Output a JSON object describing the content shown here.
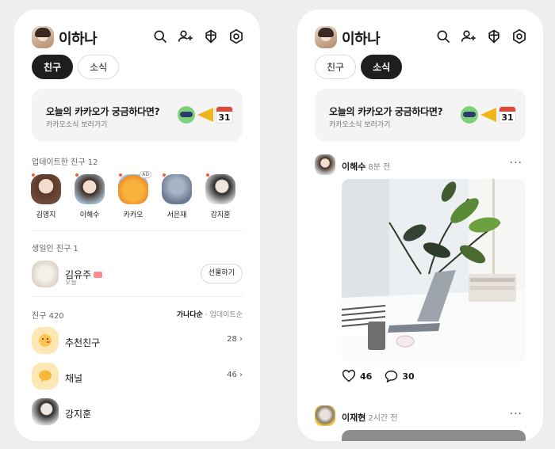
{
  "user": {
    "name": "이하나"
  },
  "header_icons": [
    "search-icon",
    "add-friend-icon",
    "gift-icon",
    "settings-icon"
  ],
  "tabs": {
    "friends": "친구",
    "news": "소식"
  },
  "banner": {
    "title": "오늘의 카카오가 궁금하다면?",
    "subtitle": "카카오소식 보러가기",
    "calendar_day": "31"
  },
  "updated": {
    "label": "업데이트한 친구 12",
    "ad_badge": "AD",
    "items": [
      {
        "name": "김영지"
      },
      {
        "name": "이해수"
      },
      {
        "name": "카카오"
      },
      {
        "name": "서은재"
      },
      {
        "name": "강지훈"
      }
    ]
  },
  "birthday": {
    "label": "생일인 친구 1",
    "name": "김유주",
    "sub": "오늘",
    "button": "선물하기"
  },
  "friends": {
    "label": "친구 420",
    "sort_active": "가나다순",
    "sort_separator": "·",
    "sort_other": "업데이트순",
    "rows": [
      {
        "name": "추천친구",
        "count": "28 ›"
      },
      {
        "name": "채널",
        "count": "46 ›"
      },
      {
        "name": "강지훈",
        "count": ""
      }
    ]
  },
  "feed": {
    "post1": {
      "author": "이해수",
      "time": "8분 전",
      "likes": "46",
      "comments": "30",
      "more": "···"
    },
    "post2": {
      "author": "이재현",
      "time": "2시간 전",
      "more": "···"
    }
  },
  "colors": {
    "accent_dark": "#1e1e1e",
    "update_dot": "#ff5a3c",
    "background": "#eeeeee"
  }
}
